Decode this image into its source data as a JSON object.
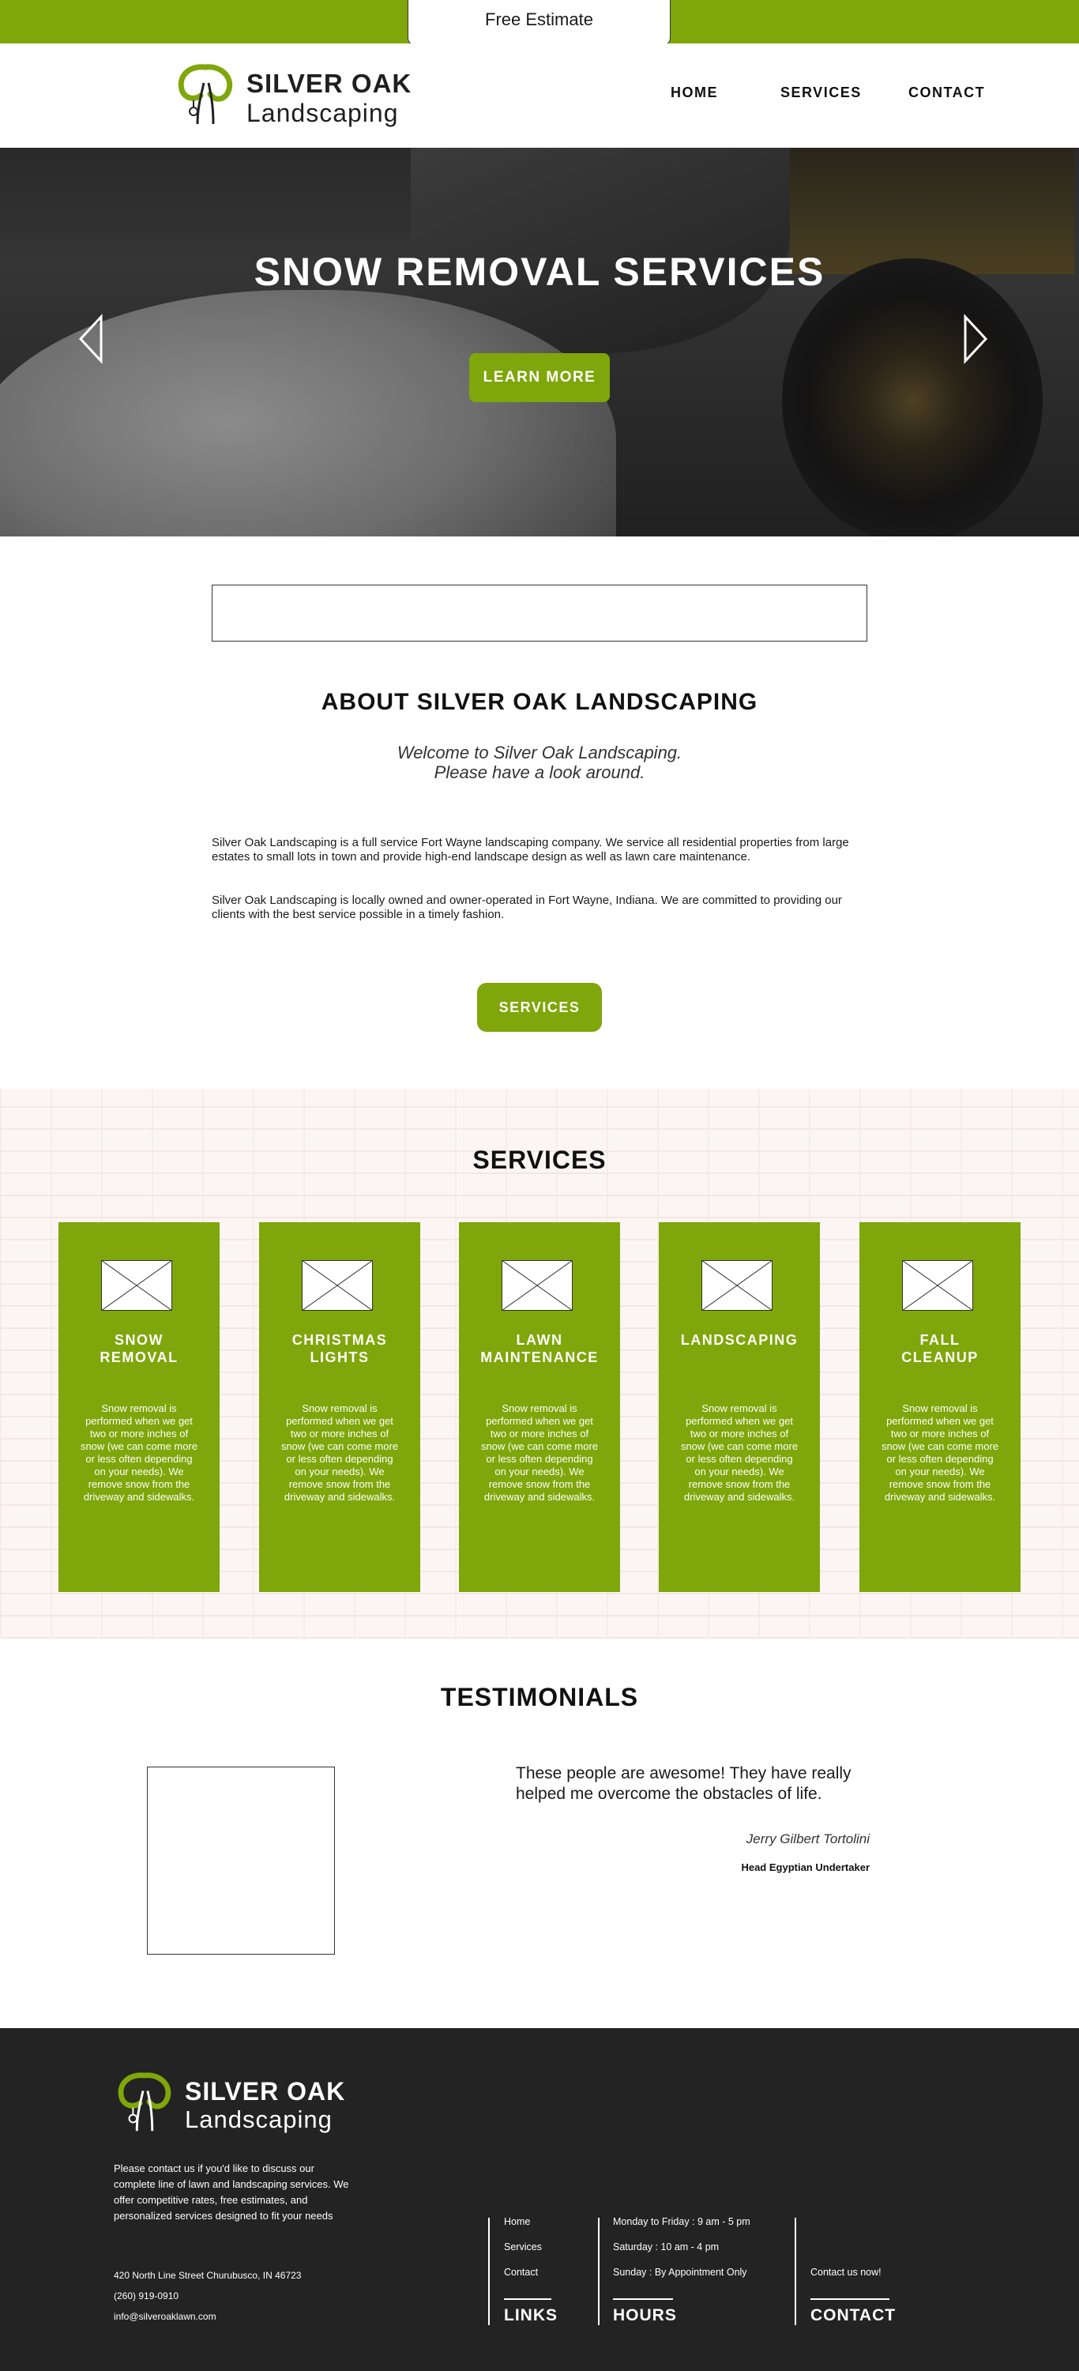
{
  "topbar": {
    "estimate_label": "Free Estimate"
  },
  "brand": {
    "name_line1": "SILVER OAK",
    "name_line2": "Landscaping",
    "accent_color": "#7fa60a"
  },
  "nav": {
    "items": [
      "HOME",
      "SERVICES",
      "CONTACT"
    ]
  },
  "hero": {
    "title": "SNOW REMOVAL SERVICES",
    "cta_label": "LEARN MORE",
    "prev_icon": "chevron-left-icon",
    "next_icon": "chevron-right-icon"
  },
  "about": {
    "search_value": "",
    "title": "ABOUT SILVER OAK LANDSCAPING",
    "subtitle_line1": "Welcome to Silver Oak Landscaping.",
    "subtitle_line2": "Please have a look around.",
    "paragraph1": "Silver Oak Landscaping is a full service Fort Wayne landscaping company. We service all residential properties from large estates to small lots in town and provide high-end landscape design as well as lawn care maintenance.",
    "paragraph2": "Silver Oak Landscaping is locally owned and owner-operated in Fort Wayne, Indiana. We are committed to providing our clients with the best service possible in a timely fashion.",
    "button_label": "SERVICES"
  },
  "services": {
    "title": "SERVICES",
    "cards": [
      {
        "title_line1": "SNOW",
        "title_line2": "REMOVAL",
        "text": "Snow removal is performed when we get two or more inches of snow (we can come more or less often depending on your needs). We remove snow from the driveway and sidewalks."
      },
      {
        "title_line1": "CHRISTMAS",
        "title_line2": "LIGHTS",
        "text": "Snow removal is performed when we get two or more inches of snow (we can come more or less often depending on your needs). We remove snow from the driveway and sidewalks."
      },
      {
        "title_line1": "LAWN",
        "title_line2": "MAINTENANCE",
        "text": "Snow removal is performed when we get two or more inches of snow (we can come more or less often depending on your needs). We remove snow from the driveway and sidewalks."
      },
      {
        "title_line1": "LANDSCAPING",
        "title_line2": "",
        "text": "Snow removal is performed when we get two or more inches of snow (we can come more or less often depending on your needs). We remove snow from the driveway and sidewalks."
      },
      {
        "title_line1": "FALL",
        "title_line2": "CLEANUP",
        "text": "Snow removal is performed when we get two or more inches of snow (we can come more or less often depending on your needs). We remove snow from the driveway and sidewalks."
      }
    ]
  },
  "testimonials": {
    "title": "TESTIMONIALS",
    "quote": "These people are awesome! They have really helped me overcome the obstacles of life.",
    "author": "Jerry Gilbert Tortolini",
    "role": "Head Egyptian Undertaker"
  },
  "footer": {
    "description": "Please contact us if you'd like to discuss our complete line of lawn and landscaping services. We offer competitive rates, free estimates, and personalized services designed to fit your needs",
    "address": "420 North Line Street Churubusco, IN 46723",
    "phone": "(260) 919-0910",
    "email": "info@silveroaklawn.com",
    "links": {
      "items": [
        "Home",
        "Services",
        "Contact"
      ],
      "heading": "LINKS"
    },
    "hours": {
      "items": [
        "Monday to Friday : 9 am - 5 pm",
        "Saturday : 10 am - 4 pm",
        "Sunday : By Appointment Only"
      ],
      "heading": "HOURS"
    },
    "contact": {
      "item": "Contact us now!",
      "heading": "CONTACT"
    }
  }
}
